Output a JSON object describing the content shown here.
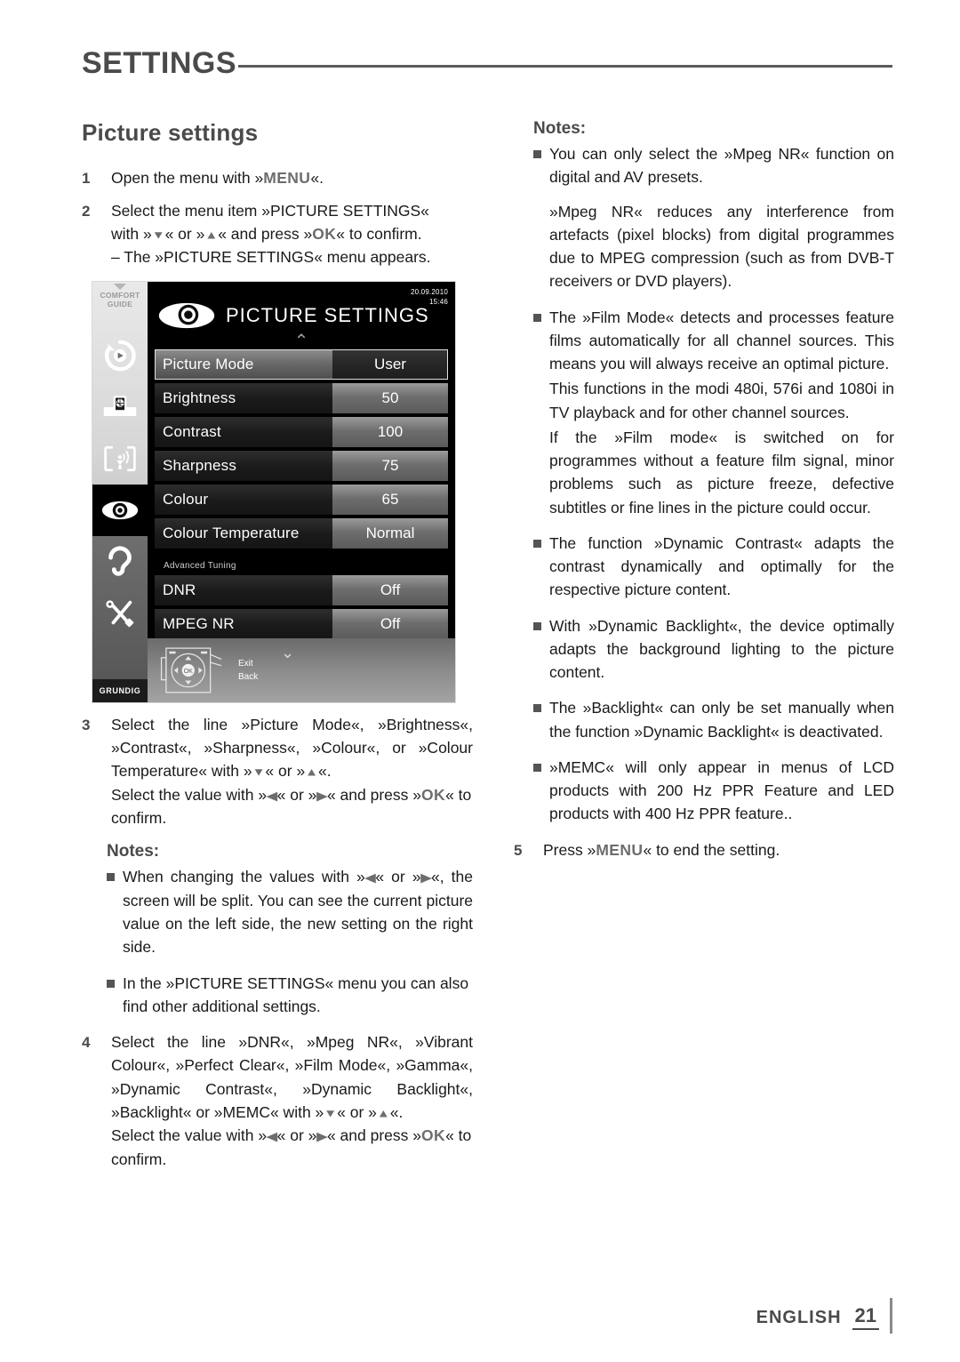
{
  "header": {
    "title": "SETTINGS"
  },
  "left": {
    "section_title": "Picture settings",
    "step1": {
      "num": "1",
      "text_a": "Open the menu with »",
      "kbd": "MENU",
      "text_b": "«."
    },
    "step2": {
      "num": "2",
      "line1": "Select the menu item »PICTURE SETTINGS«",
      "line2_a": "with »",
      "line2_b": "« or »",
      "line2_c": "« and press »",
      "line2_kbd": "OK",
      "line2_d": "« to confirm.",
      "line3": "– The »PICTURE SETTINGS« menu appears."
    },
    "step3": {
      "num": "3",
      "line1": "Select the line »Picture Mode«, »Brightness«, »Contrast«, »Sharpness«, »Colour«, or »Colour Temperature« with »",
      "line1_b": "« or »",
      "line1_c": "«.",
      "line2_a": "Select the value with »",
      "line2_b": "« or »",
      "line2_c": "« and press »",
      "line2_kbd": "OK",
      "line2_d": "« to confirm."
    },
    "notes_title": "Notes:",
    "note1": {
      "a": "When changing the values with »",
      "b": "« or »",
      "c": "«, the screen will be split. You can see the current picture value on the left side, the new setting on the right side."
    },
    "note2": {
      "text": "In the »PICTURE SETTINGS« menu you can also find other additional settings."
    },
    "step4": {
      "num": "4",
      "line1": "Select the line »DNR«, »Mpeg NR«, »Vibrant Colour«, »Perfect Clear«, »Film Mode«, »Gamma«, »Dynamic Contrast«, »Dynamic Backlight«, »Backlight« or »MEMC« with »",
      "line1_b": "« or »",
      "line1_c": "«.",
      "line2_a": "Select the value with »",
      "line2_b": "« or »",
      "line2_c": "« and press »",
      "line2_kbd": "OK",
      "line2_d": "« to confirm."
    }
  },
  "tv": {
    "comfort_guide": "COMFORT\nGUIDE",
    "comfort_line1": "COMFORT",
    "comfort_line2": "GUIDE",
    "date": "20.09.2010",
    "time": "15:46",
    "title": "PICTURE SETTINGS",
    "advanced_label": "Advanced Tuning",
    "brand": "GRUNDIG",
    "exit_label": "Exit",
    "back_label": "Back",
    "rows": [
      {
        "label": "Picture Mode",
        "value": "User",
        "selected": true
      },
      {
        "label": "Brightness",
        "value": "50",
        "selected": false
      },
      {
        "label": "Contrast",
        "value": "100",
        "selected": false
      },
      {
        "label": "Sharpness",
        "value": "75",
        "selected": false
      },
      {
        "label": "Colour",
        "value": "65",
        "selected": false
      },
      {
        "label": "Colour Temperature",
        "value": "Normal",
        "selected": false
      }
    ],
    "advanced_rows": [
      {
        "label": "DNR",
        "value": "Off",
        "selected": false
      },
      {
        "label": "MPEG NR",
        "value": "Off",
        "selected": false
      }
    ],
    "sidebar_icons": [
      "media-playback-icon",
      "tv-source-icon",
      "network-streaming-icon",
      "picture-eye-icon",
      "sound-ear-icon",
      "tools-settings-icon"
    ]
  },
  "right": {
    "notes_title": "Notes:",
    "note1": {
      "p1": "You can only select the »Mpeg NR« function on digital and AV presets.",
      "p2": "»Mpeg NR«   reduces any interference from artefacts (pixel blocks) from digital programmes due to MPEG compression (such as from DVB-T receivers or DVD players)."
    },
    "note2": {
      "p1": "The »Film Mode« detects and processes feature films automatically for all channel sources. This means you will always receive an optimal picture.",
      "p2": "This functions in the modi 480i, 576i and 1080i in TV playback and for other channel sources.",
      "p3": "If the »Film mode« is switched on for programmes without a feature film signal, minor problems such as picture freeze, defective subtitles or fine lines in the picture could occur."
    },
    "note3": {
      "p1": "The function »Dynamic Contrast« adapts the contrast dynamically and optimally for the respective picture content."
    },
    "note4": {
      "p1": "With »Dynamic Backlight«, the device optimally adapts the background lighting to the picture content."
    },
    "note5": {
      "p1": "The »Backlight« can only be set manually when the function »Dynamic Backlight« is deactivated."
    },
    "note6": {
      "p1": "»MEMC« will only appear in menus of LCD products with 200 Hz PPR Feature and LED products with 400 Hz PPR feature.."
    },
    "step5": {
      "num": "5",
      "text_a": "Press »",
      "kbd": "MENU",
      "text_b": "« to end the setting."
    }
  },
  "footer": {
    "language": "ENGLISH",
    "page": "21"
  }
}
